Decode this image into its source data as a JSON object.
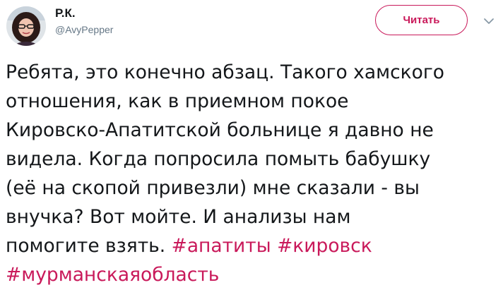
{
  "tweet": {
    "display_name": "Р.К.",
    "handle": "@AvyPepper",
    "follow_label": "Читать",
    "menu_icon": "chevron-down-icon",
    "accent_color": "#c9195a",
    "text_lines": [
      "Ребята, это конечно абзац. Такого хамского",
      "отношения, как в приемном покое",
      "Кировско-Апатитской больнице я давно не",
      "видела. Когда попросила помыть бабушку",
      "(её на скопой привезли) мне сказали - вы",
      "внучка? Вот мойте. И анализы нам",
      "помогите взять. "
    ],
    "hashtags": [
      "#апатиты",
      "#кировск",
      "#мурманскаяобласть"
    ]
  }
}
